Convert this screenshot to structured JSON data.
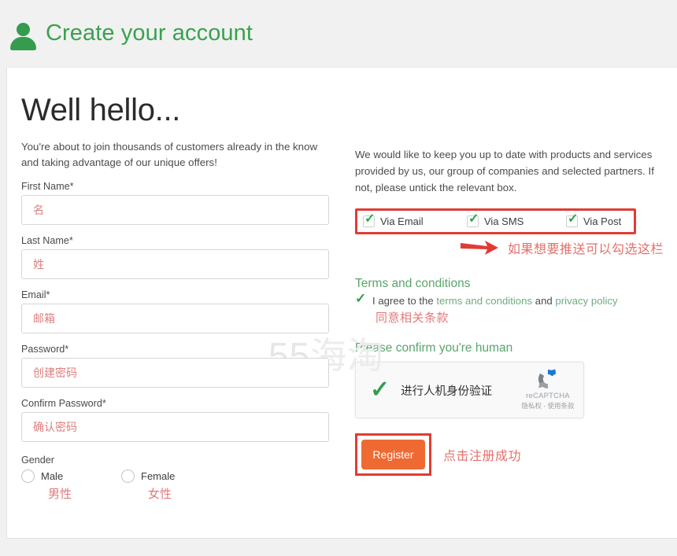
{
  "header": {
    "icon": "user-avatar-icon",
    "title": "Create your account"
  },
  "watermark": {
    "digits": "55",
    "cn": "海淘"
  },
  "left": {
    "heading": "Well hello...",
    "intro": "You're about to join thousands of customers already in the know and taking advantage of our unique offers!",
    "fields": [
      {
        "label": "First Name*",
        "placeholder": "名",
        "name": "first-name"
      },
      {
        "label": "Last Name*",
        "placeholder": "姓",
        "name": "last-name"
      },
      {
        "label": "Email*",
        "placeholder": "邮箱",
        "name": "email"
      },
      {
        "label": "Password*",
        "placeholder": "创建密码",
        "name": "password"
      },
      {
        "label": "Confirm Password*",
        "placeholder": "确认密码",
        "name": "confirm-password"
      }
    ],
    "gender": {
      "label": "Gender",
      "options": [
        {
          "label": "Male",
          "note": "男性"
        },
        {
          "label": "Female",
          "note": "女性"
        }
      ]
    }
  },
  "right": {
    "marketing_text": "We would like to keep you up to date with products and services provided by us, our group of companies and selected partners. If not, please untick the relevant box.",
    "preferences": [
      {
        "label": "Via Email",
        "checked": true
      },
      {
        "label": "Via SMS",
        "checked": true
      },
      {
        "label": "Via Post",
        "checked": true
      }
    ],
    "preferences_annotation": "如果想要推送可以勾选这栏",
    "terms": {
      "heading": "Terms and conditions",
      "agree_prefix": "I agree to the ",
      "link_terms": "terms and conditions",
      "agree_mid": " and ",
      "link_privacy": "privacy policy",
      "annotation": "同意相关条款",
      "checked": true
    },
    "captcha": {
      "heading": "Please confirm you're human",
      "label": "进行人机身份验证",
      "brand": "reCAPTCHA",
      "legal": "隐私权 - 使用条款",
      "checked": true
    },
    "register": {
      "label": "Register",
      "annotation": "点击注册成功"
    }
  },
  "colors": {
    "brand_green": "#3aa14f",
    "link_green": "#6eac7d",
    "annotation_red": "#e3706b",
    "highlight_red": "#e03c35",
    "register_orange": "#ef6a33",
    "placeholder_red": "#dd7f7f"
  }
}
